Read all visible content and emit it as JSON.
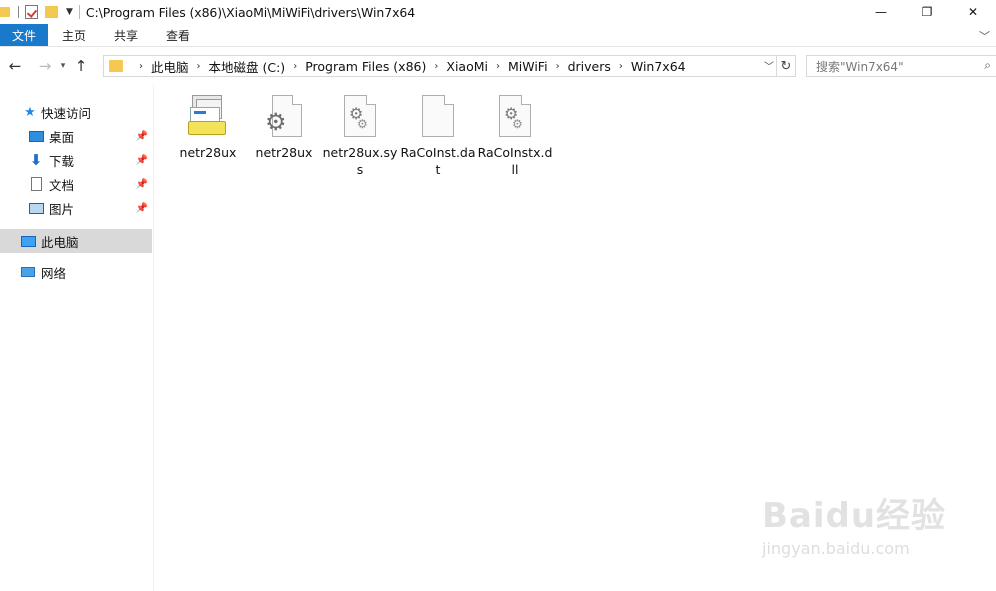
{
  "titlebar": {
    "path": "C:\\Program Files (x86)\\XiaoMi\\MiWiFi\\drivers\\Win7x64",
    "minimize": "—",
    "restore": "❐",
    "close": "✕"
  },
  "ribbon": {
    "file": "文件",
    "home": "主页",
    "share": "共享",
    "view": "查看"
  },
  "address": {
    "crumbs": [
      "此电脑",
      "本地磁盘 (C:)",
      "Program Files (x86)",
      "XiaoMi",
      "MiWiFi",
      "drivers",
      "Win7x64"
    ]
  },
  "search": {
    "placeholder": "搜索\"Win7x64\""
  },
  "nav": {
    "quick_access": "快速访问",
    "desktop": "桌面",
    "downloads": "下载",
    "documents": "文档",
    "pictures": "图片",
    "this_pc": "此电脑",
    "network": "网络"
  },
  "files": [
    {
      "name": "netr28ux",
      "icon": "setup-installer-icon"
    },
    {
      "name": "netr28ux",
      "icon": "gear-file-icon"
    },
    {
      "name": "netr28ux.sys",
      "icon": "system-file-icon"
    },
    {
      "name": "RaCoInst.dat",
      "icon": "blank-file-icon"
    },
    {
      "name": "RaCoInstx.dll",
      "icon": "dll-file-icon"
    }
  ],
  "watermark": {
    "brand": "Baidu经验",
    "url": "jingyan.baidu.com"
  },
  "colors": {
    "accent": "#1979ca",
    "folder": "#f5c851",
    "selected": "#d9d9d9"
  }
}
